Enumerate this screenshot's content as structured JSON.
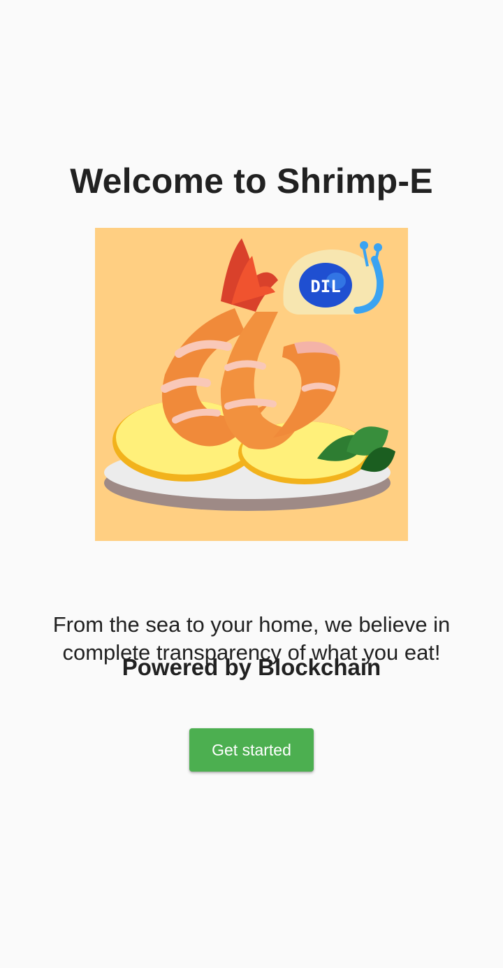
{
  "welcome": {
    "title": "Welcome to Shrimp-E"
  },
  "hero": {
    "icon": "shrimp-illustration",
    "badge_text": "DIL",
    "background_color": "#ffcf82"
  },
  "tagline": {
    "text": "From the sea to your home, we believe in complete transparency of what you eat!",
    "powered_by": "Powered by Blockchain"
  },
  "cta": {
    "label": "Get started",
    "color": "#4caf50"
  }
}
